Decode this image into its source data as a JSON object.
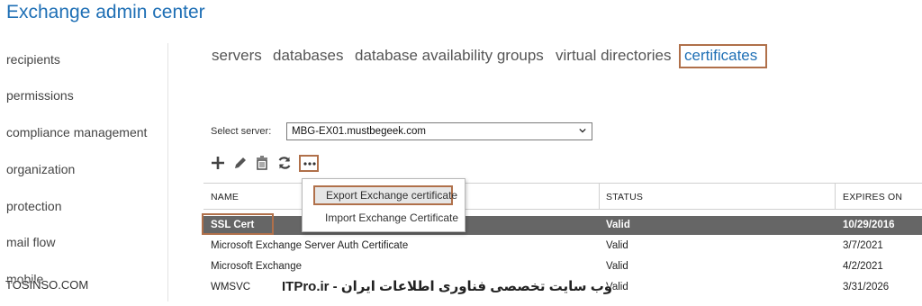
{
  "app": {
    "title": "Exchange admin center"
  },
  "sidebar": {
    "items": [
      {
        "label": "recipients"
      },
      {
        "label": "permissions"
      },
      {
        "label": "compliance management"
      },
      {
        "label": "organization"
      },
      {
        "label": "protection"
      },
      {
        "label": "mail flow"
      },
      {
        "label": "mobile"
      }
    ]
  },
  "tabs": [
    {
      "label": "servers"
    },
    {
      "label": "databases"
    },
    {
      "label": "database availability groups"
    },
    {
      "label": "virtual directories"
    },
    {
      "label": "certificates",
      "active": true
    }
  ],
  "server_select": {
    "label": "Select server:",
    "value": "MBG-EX01.mustbegeek.com"
  },
  "toolbar": {
    "icons": [
      "add-icon",
      "edit-icon",
      "delete-icon",
      "refresh-icon",
      "more-icon"
    ]
  },
  "table": {
    "columns": [
      "NAME",
      "STATUS",
      "EXPIRES ON"
    ],
    "rows": [
      {
        "name": "SSL Cert",
        "status": "Valid",
        "expires": "10/29/2016",
        "selected": true
      },
      {
        "name": "Microsoft Exchange Server Auth Certificate",
        "status": "Valid",
        "expires": "3/7/2021"
      },
      {
        "name": "Microsoft Exchange",
        "status": "Valid",
        "expires": "4/2/2021"
      },
      {
        "name": "WMSVC",
        "status": "Valid",
        "expires": "3/31/2026"
      }
    ]
  },
  "more_menu": {
    "items": [
      {
        "label": "Export Exchange certificate"
      },
      {
        "label": "Import Exchange Certificate"
      }
    ]
  },
  "watermark": {
    "left": "TOSINSO.COM",
    "right": "ITPro.ir - وب سایت تخصصی فناوری اطلاعات ایران"
  },
  "colors": {
    "accent": "#1e6fb5",
    "highlight_border": "#b0704a",
    "selected_row": "#666666"
  }
}
